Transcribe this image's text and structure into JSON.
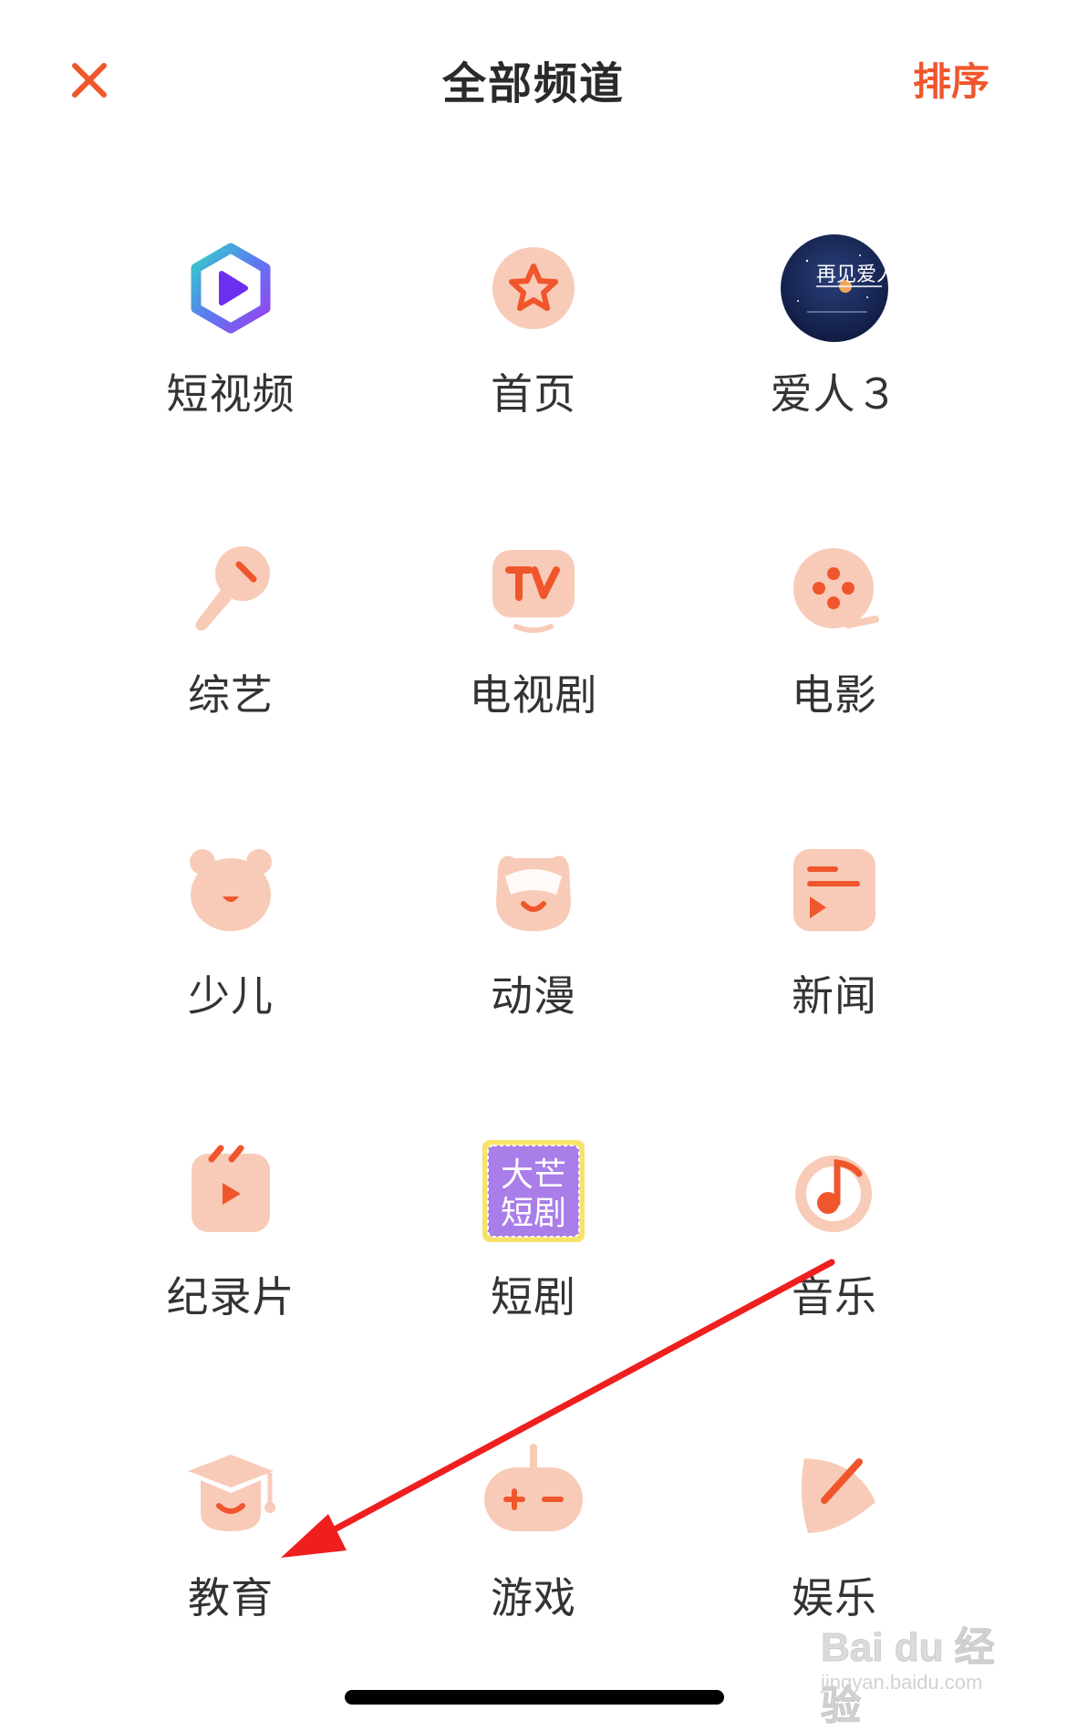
{
  "header": {
    "close_icon": "close-icon",
    "title": "全部频道",
    "sort_label": "排序"
  },
  "channels": [
    {
      "label": "短视频",
      "icon": "short-video-icon"
    },
    {
      "label": "首页",
      "icon": "home-star-icon"
    },
    {
      "label": "爱人３",
      "icon": "drama-poster-icon"
    },
    {
      "label": "综艺",
      "icon": "microphone-icon"
    },
    {
      "label": "电视剧",
      "icon": "tv-icon"
    },
    {
      "label": "电影",
      "icon": "film-reel-icon"
    },
    {
      "label": "少儿",
      "icon": "bear-icon"
    },
    {
      "label": "动漫",
      "icon": "anime-face-icon"
    },
    {
      "label": "新闻",
      "icon": "news-icon"
    },
    {
      "label": "纪录片",
      "icon": "clapperboard-icon"
    },
    {
      "label": "短剧",
      "icon": "short-drama-icon"
    },
    {
      "label": "音乐",
      "icon": "music-note-icon"
    },
    {
      "label": "教育",
      "icon": "graduation-cap-icon"
    },
    {
      "label": "游戏",
      "icon": "gamepad-icon"
    },
    {
      "label": "娱乐",
      "icon": "leaf-pen-icon"
    }
  ],
  "short_drama_badge": {
    "line1": "大芒",
    "line2": "短剧"
  },
  "poster_text": "再见爱人",
  "watermark": {
    "main": "Bai du 经验",
    "sub": "jingyan.baidu.com"
  },
  "colors": {
    "accent": "#f0562c",
    "icon_bg": "#f8cbb8",
    "icon_fg": "#f0562c",
    "arrow": "#ef1f1f"
  }
}
